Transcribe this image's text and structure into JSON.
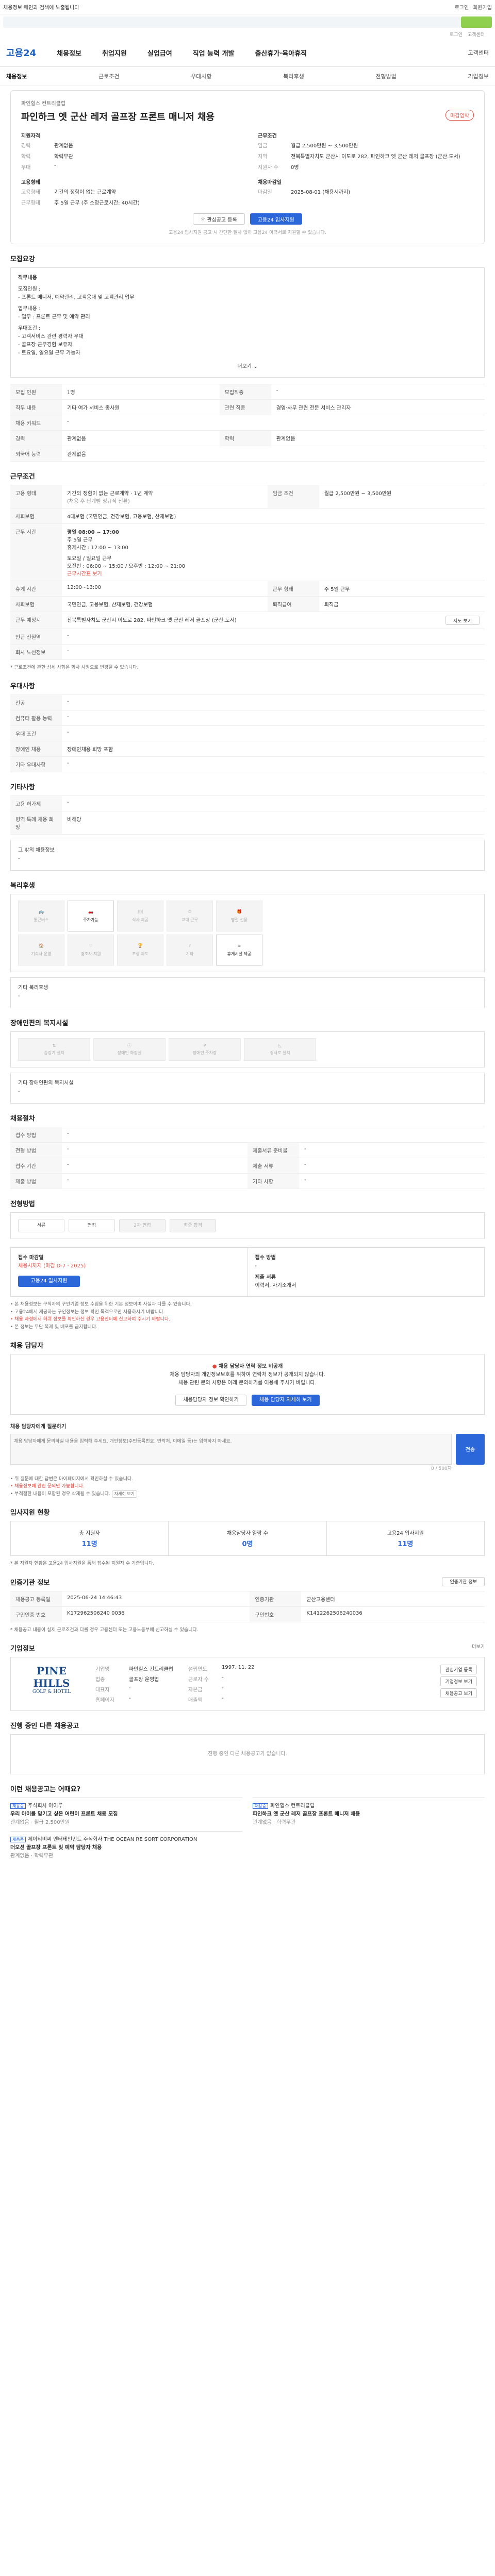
{
  "topbar": {
    "promo": "채용정보 메인과 검색에 노출됩니다",
    "btns": [
      "로그인",
      "회원가입"
    ]
  },
  "login": [
    "로그인",
    "고객센터"
  ],
  "nav": {
    "logo": "고용24",
    "items": [
      "채용정보",
      "취업지원",
      "실업급여",
      "직업 능력 개발",
      "출산휴가·육아휴직"
    ],
    "pill": "고객센터"
  },
  "subnav": [
    "채용정보",
    "근로조건",
    "우대사항",
    "복리후생",
    "전형방법",
    "기업정보"
  ],
  "header": {
    "company": "파인힐스 컨트리클럽",
    "title": "파인하크 엣 군산 레저 골프장 프론트 매니저 채용",
    "tag": "마감임박",
    "left_title": "지원자격",
    "left": [
      {
        "k": "경력",
        "v": "관계없음"
      },
      {
        "k": "학력",
        "v": "학력무관"
      },
      {
        "k": "우대",
        "v": "-"
      }
    ],
    "left2_title": "고용형태",
    "left2": [
      {
        "k": "고용형태",
        "v": "기간의 정함이 없는 근로계약"
      },
      {
        "k": "근무형태",
        "v": "주 5일 근무 (주 소정근로시간: 40시간)"
      }
    ],
    "right_title": "근무조건",
    "right": [
      {
        "k": "임금",
        "v": "월급 2,500만원 ~ 3,500만원"
      },
      {
        "k": "지역",
        "v": "전북특별자치도 군산시 이도로 282, 파인하크 엣 군산 레저 골프장 (군산.도서)"
      },
      {
        "k": "지원자 수",
        "v": "0명"
      }
    ],
    "right2_title": "채용마감일",
    "right2": [
      {
        "k": "마감일",
        "v": "2025-08-01 (채용시까지)"
      }
    ],
    "btn_interest": "관심공고 등록",
    "btn_apply": "고용24 입사지원",
    "note": "고용24 입사지원 공고 시 간단한 절차 없이 고용24 이력서로 지원할 수 있습니다."
  },
  "duty": {
    "title": "모집요강",
    "lines": [
      "직무내용",
      "모집인원 :",
      "  - 프론트 매니저, 예약관리, 고객응대 및 고객관리 업무",
      "업무내용 :",
      "  - 업무 : 프론트 근무 및 예약 관리",
      "우대조건 :",
      "  - 고객서비스 관련 경력자 우대",
      "  - 골프장 근무경험 보유자",
      "  - 토요일, 일요일 근무 가능자"
    ],
    "more": "더보기"
  },
  "recruit": {
    "rows": [
      [
        {
          "k": "모집 인원",
          "v": "1명"
        },
        {
          "k": "모집직종",
          "v": "-"
        }
      ],
      [
        {
          "k": "직무 내용",
          "v": "기타 여가 서비스 종사원"
        },
        {
          "k": "관련 직종",
          "v": "경영·사무 관련 전문 서비스 관리자"
        }
      ],
      [
        {
          "k": "채용 키워드",
          "v": "-"
        },
        {
          "k": "",
          "v": ""
        }
      ],
      [
        {
          "k": "경력",
          "v": "관계없음"
        },
        {
          "k": "학력",
          "v": "관계없음"
        }
      ],
      [
        {
          "k": "외국어 능력",
          "v": "관계없음"
        },
        {
          "k": "",
          "v": ""
        }
      ]
    ]
  },
  "cond": {
    "title": "근무조건",
    "emp_type": "기간의 정함이 없는 근로계약 · 1년 계약",
    "emp_note": "(채용 후 단계별 정규직 전환)",
    "wage": "월급 2,500만원 ~ 3,500만원",
    "insurance": "4대보험 (국민연금, 건강보험, 고용보험, 산재보험)",
    "hours_title": "근무 시간",
    "hours": [
      "평일 08:00 ~ 17:00",
      "주 5일 근무",
      "휴게시간 : 12:00 ~ 13:00",
      "토요일 / 일요일 근무",
      "오전반 : 06:00 ~ 15:00 / 오후반 : 12:00 ~ 21:00"
    ],
    "hours_link": "근무시간표 보기",
    "rows": [
      [
        {
          "k": "휴게 시간",
          "v": "12:00~13:00"
        },
        {
          "k": "근무 형태",
          "v": "주 5일 근무"
        }
      ],
      [
        {
          "k": "사회보험",
          "v": "국민연금, 고용보험, 산재보험, 건강보험"
        },
        {
          "k": "퇴직급여",
          "v": "퇴직금"
        }
      ],
      [
        {
          "k": "근무 예정지",
          "v": "전북특별자치도 군산시 이도로 282, 파인하크 엣 군산 레저 골프장 (군산.도서)"
        },
        {
          "k": "",
          "v": ""
        }
      ],
      [
        {
          "k": "인근 전철역",
          "v": "-"
        },
        {
          "k": "",
          "v": ""
        }
      ],
      [
        {
          "k": "회사 노선정보",
          "v": "-"
        },
        {
          "k": "",
          "v": ""
        }
      ]
    ],
    "map_btn": "지도 보기",
    "note": "* 근로조건에 관한 상세 사항은 회사 사정으로 변경될 수 있습니다."
  },
  "pref": {
    "title": "우대사항",
    "rows": [
      {
        "k": "전공",
        "v": "-"
      },
      {
        "k": "컴퓨터 활용 능력",
        "v": "-"
      },
      {
        "k": "우대 조건",
        "v": "-"
      },
      {
        "k": "장애인 채용",
        "v": "장애인채용 희망 포함"
      },
      {
        "k": "기타 우대사항",
        "v": "-"
      }
    ]
  },
  "etc": {
    "title": "기타사항",
    "rows": [
      {
        "k": "고용 허가제",
        "v": "-"
      },
      {
        "k": "병역 특례 채용 희망",
        "v": "비해당"
      }
    ],
    "other_title": "그 밖의 채용정보",
    "other": "-"
  },
  "welfare": {
    "title": "복리후생",
    "items": [
      {
        "icon": "bus-icon",
        "label": "통근버스",
        "on": false
      },
      {
        "icon": "car-icon",
        "label": "주차가능",
        "on": true
      },
      {
        "icon": "meal-icon",
        "label": "식사 제공",
        "on": false
      },
      {
        "icon": "clock-icon",
        "label": "교대 근무",
        "on": false
      },
      {
        "icon": "gift-icon",
        "label": "명절 선물",
        "on": false
      },
      {
        "icon": "house-icon",
        "label": "기숙사 운영",
        "on": false
      },
      {
        "icon": "heart-icon",
        "label": "경조사 지원",
        "on": false
      },
      {
        "icon": "trophy-icon",
        "label": "포상 제도",
        "on": false
      },
      {
        "icon": "question-icon",
        "label": "기타",
        "on": false
      },
      {
        "icon": "service-icon",
        "label": "휴게시설 제공",
        "on": true
      }
    ],
    "other_title": "기타 복리후생",
    "other": "-"
  },
  "disabled": {
    "title": "장애인편의 복지시설",
    "items": [
      {
        "icon": "elevator-icon",
        "label": "승강기 설치"
      },
      {
        "icon": "info-icon",
        "label": "장애인 화장실"
      },
      {
        "icon": "parking-icon",
        "label": "장애인 주차장"
      },
      {
        "icon": "ramp-icon",
        "label": "경사로 설치"
      }
    ],
    "other_title": "기타 장애인편의 복지시설",
    "other": "-"
  },
  "selection": {
    "title": "채용절차",
    "rows": [
      [
        {
          "k": "접수 방법",
          "v": "-"
        },
        {
          "k": "",
          "v": ""
        }
      ],
      [
        {
          "k": "전형 방법",
          "v": "-"
        },
        {
          "k": "제출서류 준비물",
          "v": "-"
        }
      ],
      [
        {
          "k": "접수 기간",
          "v": "-"
        },
        {
          "k": "제출 서류",
          "v": "-"
        }
      ],
      [
        {
          "k": "제출 방법",
          "v": "-"
        },
        {
          "k": "기타 사항",
          "v": "-"
        }
      ]
    ]
  },
  "process": {
    "title": "전형방법",
    "steps": [
      {
        "label": "서류",
        "off": false
      },
      {
        "label": "면접",
        "off": false
      },
      {
        "label": "2차 면접",
        "off": true
      },
      {
        "label": "최종 합격",
        "off": true
      }
    ]
  },
  "apply": {
    "left_title": "접수 마감일",
    "left_val": "채용시까지 (마감 D-7 · 2025)",
    "btn": "고용24 입사지원",
    "right_title": "접수 방법",
    "right_val": "-",
    "right2_title": "제출 서류",
    "right2_val": "이력서, 자기소개서"
  },
  "notes": [
    "• 본 채용정보는 구직자의 구인기업 정보 수집을 위한 기본 정보이며 사실과 다를 수 있습니다.",
    "• 고용24에서 제공하는 구인정보는 정보 확인 목적으로만 사용하시기 바랍니다.",
    "• 채용 과정에서 허위 정보를 확인하신 경우 고용센터에 신고하여 주시기 바랍니다.",
    "• 본 정보는 무단 복제 및 배포를 금지합니다."
  ],
  "contact": {
    "title": "채용 담당자",
    "alert_title": "채용 담당자 연락 정보 비공개",
    "alert_body": "채용 담당자의 개인정보보호를 위하여 연락처 정보가 공개되지 않습니다.",
    "alert_body2": "채용 관련 문의 사항은 아래 문의하기를 이용해 주시기 바랍니다.",
    "btn1": "채용담당자 정보 확인하기",
    "btn2": "채용 담당자 자세히 보기"
  },
  "qa": {
    "title": "채용 담당자에게 질문하기",
    "placeholder": "채용 담당자에게 문의하실 내용을 입력해 주세요. 개인정보(주민등록번호, 연락처, 이메일 등)는 입력하지 마세요.",
    "btn": "전송",
    "count": "0 / 500자",
    "help_btn": "자세히 보기",
    "notes": [
      "• 위 질문에 대한 답변은 마이페이지에서 확인하실 수 있습니다.",
      "• 채용정보에 관한 문의만 가능합니다.",
      "• 부적절한 내용이 포함된 경우 삭제될 수 있습니다."
    ]
  },
  "status": {
    "title": "입사지원 현황",
    "items": [
      {
        "label": "총 지원자",
        "val": "11명"
      },
      {
        "label": "채용담당자 열람 수",
        "val": "0명"
      },
      {
        "label": "고용24 입사지원",
        "val": "11명"
      }
    ],
    "note": "* 본 지원자 현황은 고용24 입사지원을 통해 접수된 지원자 수 기준입니다."
  },
  "mgmt": {
    "title": "인증기관 정보",
    "btn": "인증기관 정보",
    "rows": [
      [
        {
          "k": "채용공고 등록일",
          "v": "2025-06-24 14:46:43"
        },
        {
          "k": "인증기관",
          "v": "군산고용센터"
        }
      ],
      [
        {
          "k": "구인인증 번호",
          "v": "K172962506240 0036"
        },
        {
          "k": "구인번호",
          "v": "K1412262506240036"
        }
      ]
    ],
    "note": "* 채용공고 내용이 실제 근로조건과 다를 경우 고용센터 또는 고용노동부에 신고하실 수 있습니다."
  },
  "company": {
    "title": "기업정보",
    "more": "더보기",
    "logo": "PINE HILLS",
    "logo_sub": "GOLF & HOTEL",
    "rows": [
      {
        "k": "기업명",
        "v": "파인힐스 컨트리클럽"
      },
      {
        "k": "업종",
        "v": "골프장 운영업"
      },
      {
        "k": "대표자",
        "v": "-"
      },
      {
        "k": "설립연도",
        "v": "1997. 11. 22"
      },
      {
        "k": "근로자 수",
        "v": "-"
      },
      {
        "k": "자본금",
        "v": "-"
      },
      {
        "k": "홈페이지",
        "v": "-"
      },
      {
        "k": "매출액",
        "v": "-"
      }
    ],
    "btns": [
      "관심기업 등록",
      "기업정보 보기",
      "채용공고 보기"
    ]
  },
  "closed": {
    "title": "진행 중인 다른 채용공고",
    "empty": "진행 중인 다른 채용공고가 없습니다."
  },
  "similar": {
    "title": "이런 채용공고는 어때요?",
    "jobs": [
      {
        "badge": "채용중",
        "company": "주식회사 아이루",
        "title": "우리 아이를 맡기고 싶은 어린이 프론트 채용 모집",
        "meta": [
          "관계없음",
          "월급 2,500만원"
        ]
      },
      {
        "badge": "채용중",
        "company": "파인힐스 컨트리클럽",
        "title": "파인하크 엣 군산 레저 골프장 프론트 매니저 채용",
        "meta": [
          "관계없음",
          "학력무관"
        ]
      }
    ],
    "jobs2": [
      {
        "badge": "채용중",
        "company": "제이티비씨 엔터테인먼트 주식회사 THE OCEAN RE SORT CORPORATION",
        "title": "더오션 골프장 프론트 및 예약 담당자 채용",
        "meta": [
          "관계없음",
          "학력무관"
        ]
      }
    ]
  }
}
